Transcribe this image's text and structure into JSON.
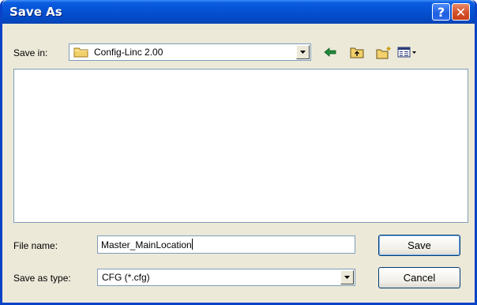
{
  "window": {
    "title": "Save As"
  },
  "titlebar": {
    "help_label": "?",
    "close_label": "✕"
  },
  "save_in": {
    "label": "Save in:",
    "value": "Config-Linc 2.00",
    "folder_icon": "folder-icon"
  },
  "toolbar": {
    "icons": [
      "back-arrow-icon",
      "up-folder-icon",
      "new-folder-icon",
      "view-menu-icon"
    ]
  },
  "file_list": {
    "items": []
  },
  "file_name": {
    "label": "File name:",
    "value": "Master_MainLocation"
  },
  "save_as_type": {
    "label": "Save as type:",
    "value": "CFG (*.cfg)"
  },
  "buttons": {
    "save": "Save",
    "cancel": "Cancel"
  },
  "colors": {
    "titlebar": "#0552d4",
    "accent_green": "#1f8a3a",
    "folder_yellow": "#f2d06b"
  }
}
